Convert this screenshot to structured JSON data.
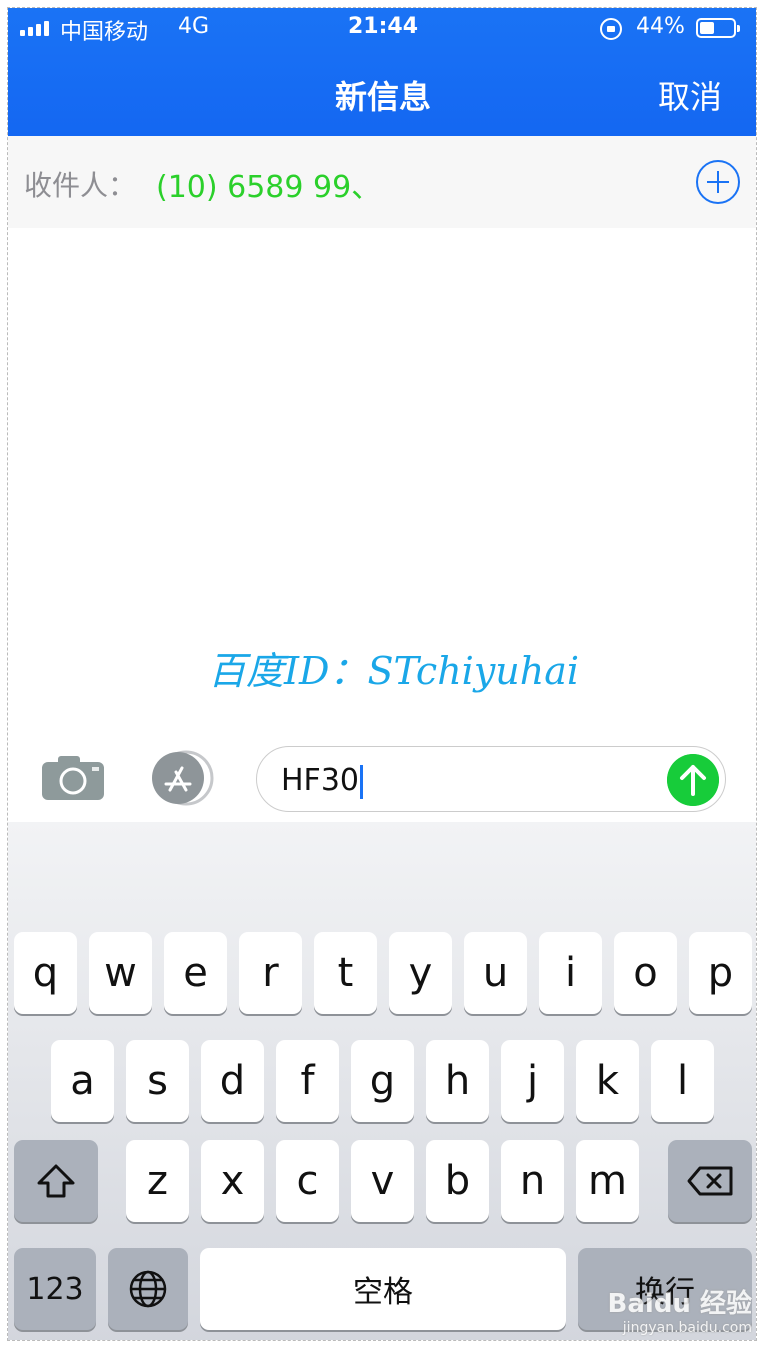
{
  "status_bar": {
    "carrier": "中国移动",
    "network": "4G",
    "time": "21:44",
    "battery_percent": "44%",
    "battery_level": 0.44
  },
  "nav": {
    "title": "新信息",
    "cancel_label": "取消"
  },
  "recipient": {
    "label": "收件人：",
    "value": "(10) 6589 99、"
  },
  "watermark": "百度ID：STchiyuhai",
  "composer": {
    "message_text": "HF30"
  },
  "keyboard": {
    "row1": [
      "q",
      "w",
      "e",
      "r",
      "t",
      "y",
      "u",
      "i",
      "o",
      "p"
    ],
    "row2": [
      "a",
      "s",
      "d",
      "f",
      "g",
      "h",
      "j",
      "k",
      "l"
    ],
    "row3": [
      "z",
      "x",
      "c",
      "v",
      "b",
      "n",
      "m"
    ],
    "numbers_label": "123",
    "space_label": "空格",
    "return_label": "换行"
  },
  "baidu_mark": {
    "logo": "Baidu 经验",
    "url": "jingyan.baidu.com"
  },
  "colors": {
    "header_blue": "#1467f2",
    "recipient_green": "#2bd02b",
    "send_green": "#17cc3a"
  }
}
